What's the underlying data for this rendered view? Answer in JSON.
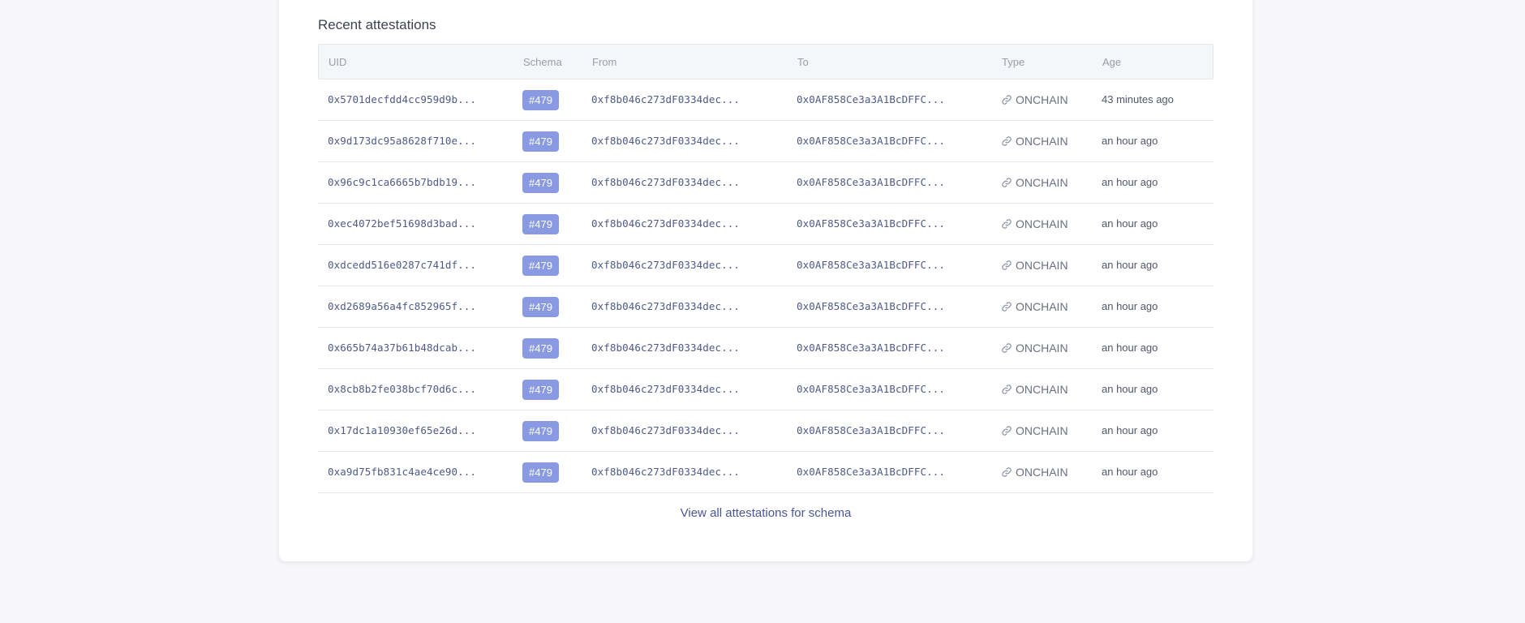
{
  "section": {
    "title": "Recent attestations"
  },
  "table": {
    "headers": {
      "uid": "UID",
      "schema": "Schema",
      "from": "From",
      "to": "To",
      "type": "Type",
      "age": "Age"
    },
    "rows": [
      {
        "uid": "0x5701decfdd4cc959d9b...",
        "schema": "#479",
        "from": "0xf8b046c273dF0334dec...",
        "to": "0x0AF858Ce3a3A1BcDFFC...",
        "type": "ONCHAIN",
        "age": "43 minutes ago"
      },
      {
        "uid": "0x9d173dc95a8628f710e...",
        "schema": "#479",
        "from": "0xf8b046c273dF0334dec...",
        "to": "0x0AF858Ce3a3A1BcDFFC...",
        "type": "ONCHAIN",
        "age": "an hour ago"
      },
      {
        "uid": "0x96c9c1ca6665b7bdb19...",
        "schema": "#479",
        "from": "0xf8b046c273dF0334dec...",
        "to": "0x0AF858Ce3a3A1BcDFFC...",
        "type": "ONCHAIN",
        "age": "an hour ago"
      },
      {
        "uid": "0xec4072bef51698d3bad...",
        "schema": "#479",
        "from": "0xf8b046c273dF0334dec...",
        "to": "0x0AF858Ce3a3A1BcDFFC...",
        "type": "ONCHAIN",
        "age": "an hour ago"
      },
      {
        "uid": "0xdcedd516e0287c741df...",
        "schema": "#479",
        "from": "0xf8b046c273dF0334dec...",
        "to": "0x0AF858Ce3a3A1BcDFFC...",
        "type": "ONCHAIN",
        "age": "an hour ago"
      },
      {
        "uid": "0xd2689a56a4fc852965f...",
        "schema": "#479",
        "from": "0xf8b046c273dF0334dec...",
        "to": "0x0AF858Ce3a3A1BcDFFC...",
        "type": "ONCHAIN",
        "age": "an hour ago"
      },
      {
        "uid": "0x665b74a37b61b48dcab...",
        "schema": "#479",
        "from": "0xf8b046c273dF0334dec...",
        "to": "0x0AF858Ce3a3A1BcDFFC...",
        "type": "ONCHAIN",
        "age": "an hour ago"
      },
      {
        "uid": "0x8cb8b2fe038bcf70d6c...",
        "schema": "#479",
        "from": "0xf8b046c273dF0334dec...",
        "to": "0x0AF858Ce3a3A1BcDFFC...",
        "type": "ONCHAIN",
        "age": "an hour ago"
      },
      {
        "uid": "0x17dc1a10930ef65e26d...",
        "schema": "#479",
        "from": "0xf8b046c273dF0334dec...",
        "to": "0x0AF858Ce3a3A1BcDFFC...",
        "type": "ONCHAIN",
        "age": "an hour ago"
      },
      {
        "uid": "0xa9d75fb831c4ae4ce90...",
        "schema": "#479",
        "from": "0xf8b046c273dF0334dec...",
        "to": "0x0AF858Ce3a3A1BcDFFC...",
        "type": "ONCHAIN",
        "age": "an hour ago"
      }
    ]
  },
  "footer": {
    "view_all_label": "View all attestations for schema"
  },
  "icons": {
    "type_icon": "link-icon"
  },
  "colors": {
    "badge": "#8a9ae2",
    "link": "#4a5694",
    "mono_text": "#4f5a86"
  }
}
